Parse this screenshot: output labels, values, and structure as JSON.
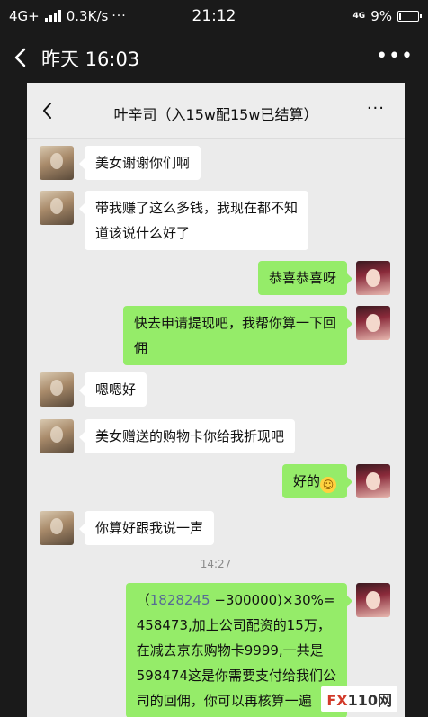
{
  "status_bar": {
    "network": "4G+",
    "speed": "0.3K/s",
    "more_dots": "···",
    "time": "21:12",
    "network_right": "4G",
    "battery": "9%"
  },
  "viewer": {
    "title": "昨天 16:03",
    "more": "•••"
  },
  "chat": {
    "title": "叶辛司（入15w配15w已结算）",
    "more": "···",
    "timestamp": "14:27",
    "messages": [
      {
        "side": "in",
        "text": "美女谢谢你们啊"
      },
      {
        "side": "in",
        "lines": [
          "带我赚了这么多钱，我现在都不知",
          "道该说什么好了"
        ]
      },
      {
        "side": "out",
        "text": "恭喜恭喜呀"
      },
      {
        "side": "out",
        "lines": [
          "快去申请提现吧，我帮你算一下回",
          "佣"
        ]
      },
      {
        "side": "in",
        "text": "嗯嗯好"
      },
      {
        "side": "in",
        "text": "美女赠送的购物卡你给我折现吧"
      },
      {
        "side": "out",
        "text": "好的",
        "emoji": "smile-emoji"
      },
      {
        "side": "in",
        "text": "你算好跟我说一声"
      },
      {
        "side": "out",
        "first_prefix": "（",
        "number": "1828245",
        "first_suffix": " −300000)×30%=",
        "lines": [
          "458473,加上公司配资的15万，",
          "在减去京东购物卡9999,一共是",
          "598474这是你需要支付给我们公",
          "司的回佣，你可以再核算一遍"
        ]
      }
    ]
  },
  "watermark": {
    "fx": "FX",
    "rest": "110网"
  },
  "colors": {
    "outgoing_bubble": "#95ec69",
    "incoming_bubble": "#ffffff",
    "chat_background": "#ebebeb",
    "link_number": "#576b95"
  }
}
